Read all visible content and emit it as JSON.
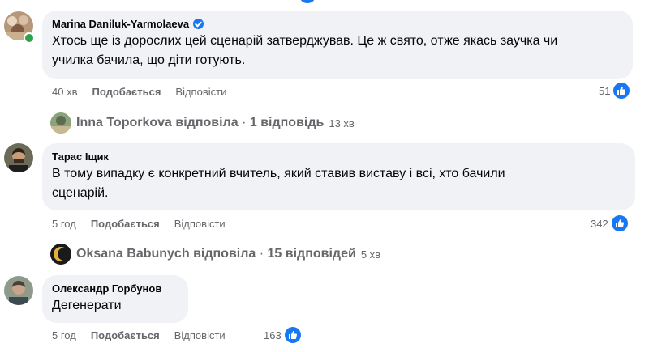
{
  "comments": [
    {
      "author": "Marina Daniluk-Yarmolaeva",
      "verified": true,
      "text_lines": [
        "Хтось ще із дорослих цей сценарій затверджував. Це ж свято, отже якась заучка чи",
        "училка бачила, що діти готують."
      ],
      "time": "40 хв",
      "like_label": "Подобається",
      "reply_label": "Відповісти",
      "reactions": "51",
      "thread": {
        "name": "Inna Toporkova",
        "verb": "відповіла",
        "separator": "·",
        "count": "1 відповідь",
        "time": "13 хв"
      }
    },
    {
      "author": "Тарас Іщик",
      "verified": false,
      "text_lines": [
        "В тому випадку є конкретний вчитель, який ставив виставу і всі, хто бачили",
        "сценарій."
      ],
      "time": "5 год",
      "like_label": "Подобається",
      "reply_label": "Відповісти",
      "reactions": "342",
      "thread": {
        "name": "Oksana Babunych",
        "verb": "відповіла",
        "separator": "·",
        "count": "15 відповідей",
        "time": "5 хв"
      }
    },
    {
      "author": "Олександр Горбунов",
      "verified": false,
      "text_lines": [
        "Дегенерати"
      ],
      "time": "5 год",
      "like_label": "Подобається",
      "reply_label": "Відповісти",
      "reactions": "163"
    }
  ],
  "colors": {
    "accent": "#1877f2",
    "bubble": "#f0f2f5",
    "meta_text": "#65676b",
    "online": "#31a24c"
  },
  "icons": {
    "reaction": "like-thumb-icon",
    "verified": "verified-badge-icon"
  }
}
